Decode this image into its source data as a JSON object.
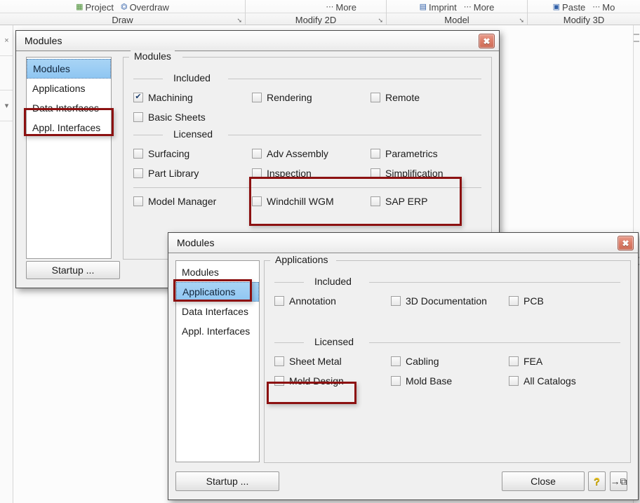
{
  "ribbon": {
    "groups": [
      {
        "title": "Draw",
        "has_launcher": true,
        "commands": [
          {
            "icon": "project-icon",
            "label": "Project"
          },
          {
            "icon": "overdraw-icon",
            "label": "Overdraw"
          }
        ]
      },
      {
        "title": "Modify 2D",
        "has_launcher": true,
        "commands": [
          {
            "icon": "more-icon",
            "label": "More"
          }
        ]
      },
      {
        "title": "Model",
        "has_launcher": true,
        "commands": [
          {
            "icon": "imprint-icon",
            "label": "Imprint"
          },
          {
            "icon": "more-icon",
            "label": "More"
          }
        ]
      },
      {
        "title": "Modify 3D",
        "has_launcher": false,
        "commands": [
          {
            "icon": "paste-icon",
            "label": "Paste"
          },
          {
            "icon": "more-icon",
            "label": "Mo"
          }
        ]
      }
    ],
    "launcher_glyph": "➘"
  },
  "left_dock": {
    "close_glyph": "×",
    "dropdown_glyph": "▾"
  },
  "dialog_modules": {
    "title": "Modules",
    "close_glyph": "✖",
    "nav_items": [
      {
        "label": "Modules",
        "selected": true
      },
      {
        "label": "Applications",
        "selected": false
      },
      {
        "label": "Data Interfaces",
        "selected": false
      },
      {
        "label": "Appl. Interfaces",
        "selected": false
      }
    ],
    "group_legend": "Modules",
    "section_included": "Included",
    "section_licensed": "Licensed",
    "checkboxes": {
      "included": [
        {
          "label": "Machining",
          "checked": true
        },
        {
          "label": "Rendering",
          "checked": false
        },
        {
          "label": "Remote",
          "checked": false
        },
        {
          "label": "Basic Sheets",
          "checked": false
        }
      ],
      "licensed": [
        {
          "label": "Surfacing",
          "checked": false
        },
        {
          "label": "Adv Assembly",
          "checked": false
        },
        {
          "label": "Parametrics",
          "checked": false
        },
        {
          "label": "Part Library",
          "checked": false
        },
        {
          "label": "Inspection",
          "checked": false
        },
        {
          "label": "Simplification",
          "checked": false
        }
      ],
      "extra": [
        {
          "label": "Model Manager",
          "checked": false
        },
        {
          "label": "Windchill WGM",
          "checked": false
        },
        {
          "label": "SAP ERP",
          "checked": false
        }
      ]
    },
    "startup_label": "Startup ..."
  },
  "dialog_applications": {
    "title": "Modules",
    "close_glyph": "✖",
    "nav_items": [
      {
        "label": "Modules",
        "selected": false
      },
      {
        "label": "Applications",
        "selected": true
      },
      {
        "label": "Data Interfaces",
        "selected": false
      },
      {
        "label": "Appl. Interfaces",
        "selected": false
      }
    ],
    "group_legend": "Applications",
    "section_included": "Included",
    "section_licensed": "Licensed",
    "checkboxes": {
      "included": [
        {
          "label": "Annotation",
          "checked": false
        },
        {
          "label": "3D Documentation",
          "checked": false
        },
        {
          "label": "PCB",
          "checked": false
        }
      ],
      "licensed": [
        {
          "label": "Sheet Metal",
          "checked": false
        },
        {
          "label": "Cabling",
          "checked": false
        },
        {
          "label": "FEA",
          "checked": false
        },
        {
          "label": "Mold Design",
          "checked": false
        },
        {
          "label": "Mold Base",
          "checked": false
        },
        {
          "label": "All Catalogs",
          "checked": false
        }
      ]
    },
    "startup_label": "Startup ...",
    "close_label": "Close",
    "help_glyph": "?",
    "pin_glyph": "→⧉"
  },
  "annotations": {
    "color": "#8c1111",
    "regions": [
      "modules-nav-selected-highlight",
      "modules-licensed-right-columns-highlight",
      "applications-nav-selected-highlight",
      "mold-design-checkbox-highlight"
    ]
  }
}
